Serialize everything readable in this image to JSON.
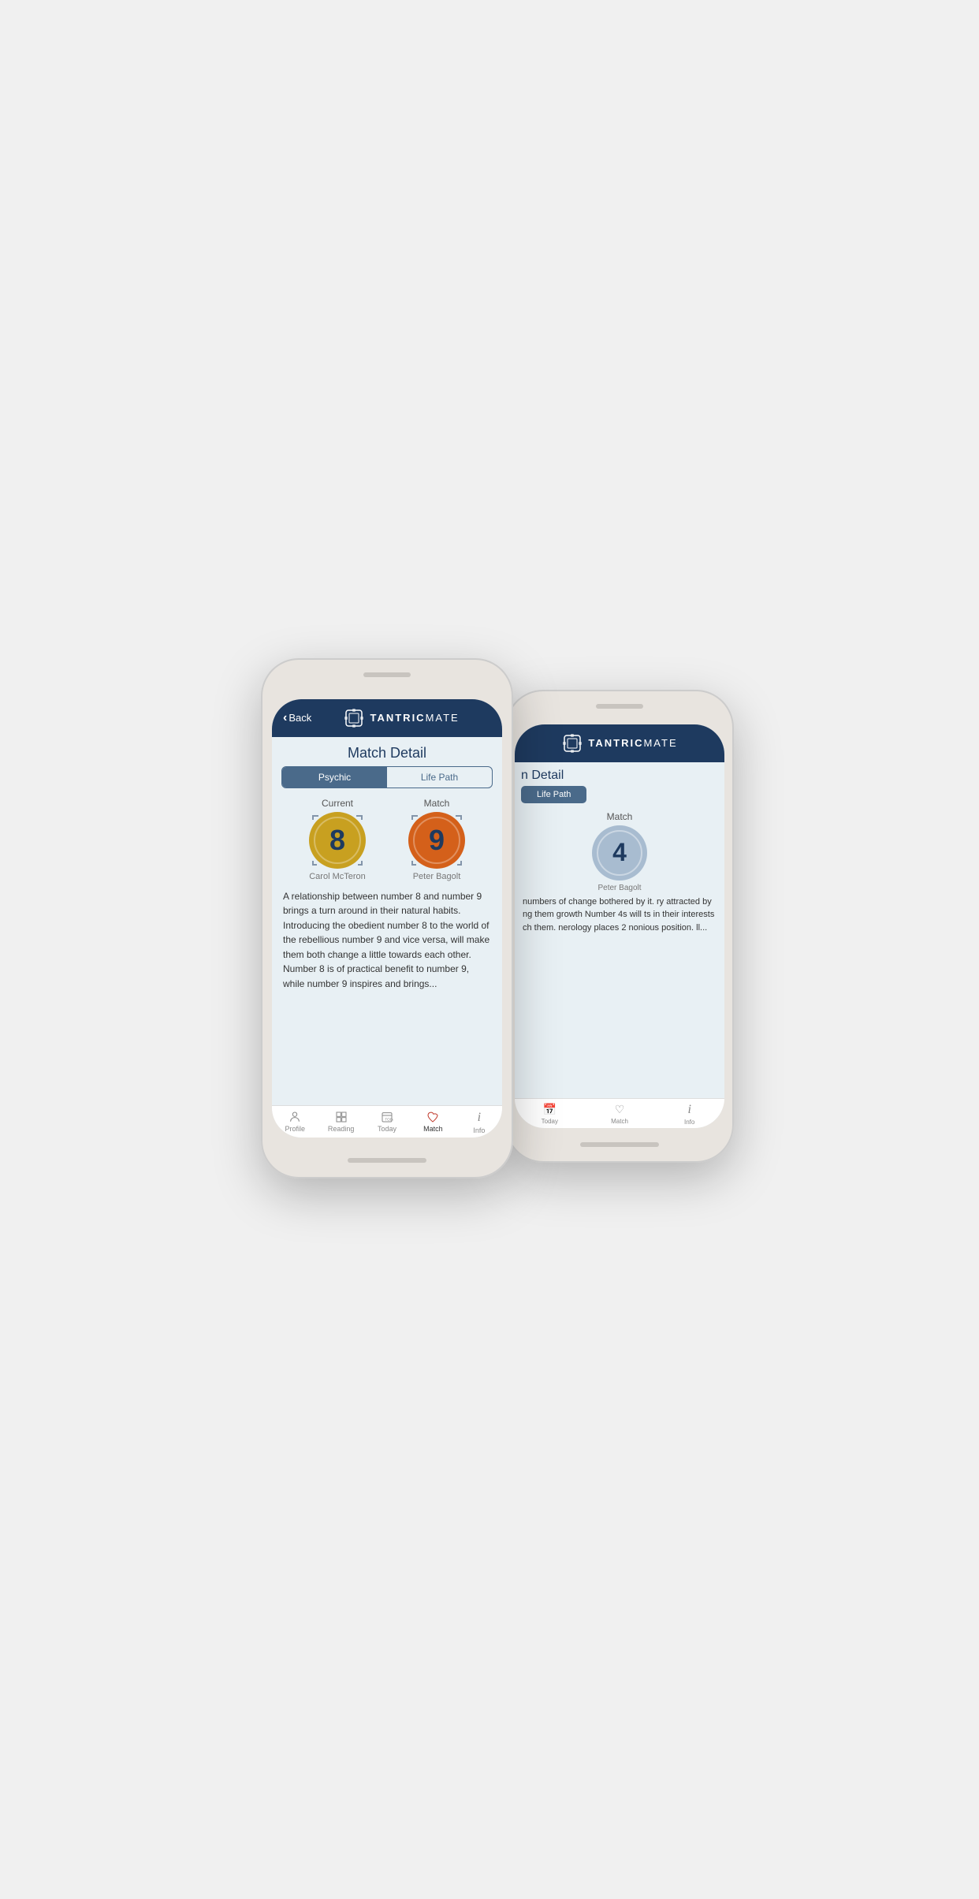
{
  "app": {
    "logo_bold": "TANTRIC",
    "logo_light": "MATE",
    "back_label": "Back",
    "page_title": "Match Detail",
    "back_page_title": "n Detail"
  },
  "tabs": {
    "psychic": "Psychic",
    "life_path": "Life Path"
  },
  "front_phone": {
    "current_label": "Current",
    "match_label": "Match",
    "current_number": "8",
    "match_number": "9",
    "current_name": "Carol McTeron",
    "match_name": "Peter Bagolt",
    "active_tab": "psychic",
    "description": "A relationship between number 8 and number 9 brings a turn around in their natural habits. Introducing the obedient number 8 to the world of the rebellious number 9 and vice versa, will make them both change a little towards each other. Number 8 is of practical benefit to number 9, while number 9 inspires and brings..."
  },
  "back_phone": {
    "match_label": "Match",
    "match_number": "4",
    "match_name": "Peter Bagolt",
    "active_tab": "Life Path",
    "description": "numbers of change bothered by it. ry attracted by ng them growth Number 4s will ts in their interests ch them. nerology places 2 nonious position. ll...",
    "page_title_partial": "n Detail"
  },
  "bottom_nav": {
    "profile": "Profile",
    "reading": "Reading",
    "today": "Today",
    "match": "Match",
    "info": "Info"
  },
  "icons": {
    "profile": "👤",
    "reading": "▦",
    "today": "📅",
    "match": "♡",
    "info": "ℹ",
    "back_chevron": "‹",
    "logo_bracket": "⬛"
  },
  "colors": {
    "header_bg": "#1e3a5f",
    "tab_active": "#4a6a8a",
    "number_gold": "#c8a020",
    "number_orange": "#d4601a",
    "number_blue_gray": "#a8bcd0",
    "accent_red": "#c0392b"
  }
}
